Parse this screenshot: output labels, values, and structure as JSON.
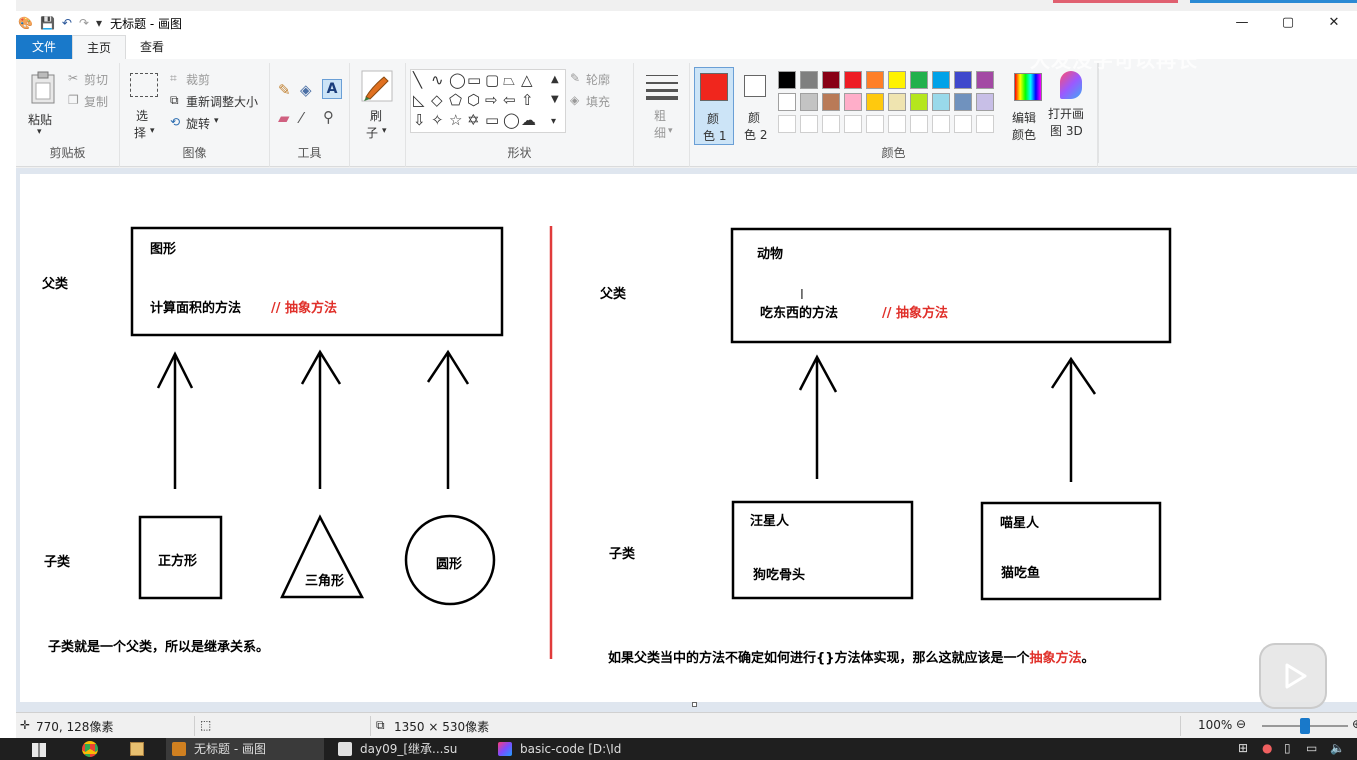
{
  "window": {
    "title": "无标题 - 画图",
    "quick_access": [
      "💾",
      "↶",
      "↷",
      "▾"
    ],
    "controls": [
      "—",
      "▢",
      "✕"
    ]
  },
  "tabs": [
    {
      "label": "文件"
    },
    {
      "label": "主页"
    },
    {
      "label": "查看"
    }
  ],
  "ribbon": {
    "clipboard": {
      "paste": "粘贴",
      "paste_arrow": "▾",
      "cut": "剪切",
      "copy": "复制",
      "group": "剪贴板"
    },
    "image": {
      "select": "选",
      "select2": "择",
      "select_arrow": "▾",
      "crop": "裁剪",
      "resize": "重新调整大小",
      "rotate": "旋转",
      "rotate_arrow": "▾",
      "group": "图像"
    },
    "tools": {
      "text_tool": "A",
      "group": "工具"
    },
    "brush": {
      "label1": "刷",
      "label2": "子",
      "arrow": "▾"
    },
    "shapes": {
      "outline": "轮廓",
      "fill": "填充",
      "group": "形状"
    },
    "size": {
      "label1": "粗",
      "label2": "细",
      "arrow": "▾"
    },
    "color1": {
      "label1": "颜",
      "label2": "色 1",
      "color": "#f0261d"
    },
    "color2": {
      "label1": "颜",
      "label2": "色 2",
      "color": "#ffffff"
    },
    "palette": {
      "row1": [
        "#000000",
        "#7f7f7f",
        "#880015",
        "#ed1c24",
        "#ff7f27",
        "#fff200",
        "#22b14c",
        "#00a2e8",
        "#3f48cc",
        "#a349a4"
      ],
      "row2": [
        "#ffffff",
        "#c3c3c3",
        "#b97a57",
        "#ffaec9",
        "#ffc90e",
        "#efe4b0",
        "#b5e61d",
        "#99d9ea",
        "#7092be",
        "#c8bfe7"
      ],
      "group": "颜色"
    },
    "edit_colors": {
      "label1": "编辑",
      "label2": "颜色"
    },
    "paint3d": {
      "label1": "打开画",
      "label2": "图 3D"
    }
  },
  "watermark": "大发没字可以再长",
  "canvas": {
    "left": {
      "parent_label": "父类",
      "parent_box_title": "图形",
      "parent_box_method": "计算面积的方法",
      "parent_box_comment": "// 抽象方法",
      "child_label": "子类",
      "children": [
        "正方形",
        "三角形",
        "圆形"
      ],
      "note": "子类就是一个父类，所以是继承关系。"
    },
    "right": {
      "parent_label": "父类",
      "parent_box_title": "动物",
      "parent_box_method": "吃东西的方法",
      "parent_box_comment": "// 抽象方法",
      "child_label": "子类",
      "children": [
        {
          "name": "汪星人",
          "action": "狗吃骨头"
        },
        {
          "name": "喵星人",
          "action": "猫吃鱼"
        }
      ],
      "note_prefix": "如果父类当中的方法不确定如何进行{}方法体实现，那么这就应该是一个",
      "note_highlight": "抽象方法",
      "note_suffix": "。"
    }
  },
  "status": {
    "cursor": "770, 128像素",
    "canvas_size": "1350 × 530像素",
    "zoom": "100%",
    "zoom_level": 0.5
  },
  "taskbar": {
    "items": [
      "无标题 - 画图",
      "day09_[继承...su",
      "basic-code [D:\\Id"
    ]
  }
}
